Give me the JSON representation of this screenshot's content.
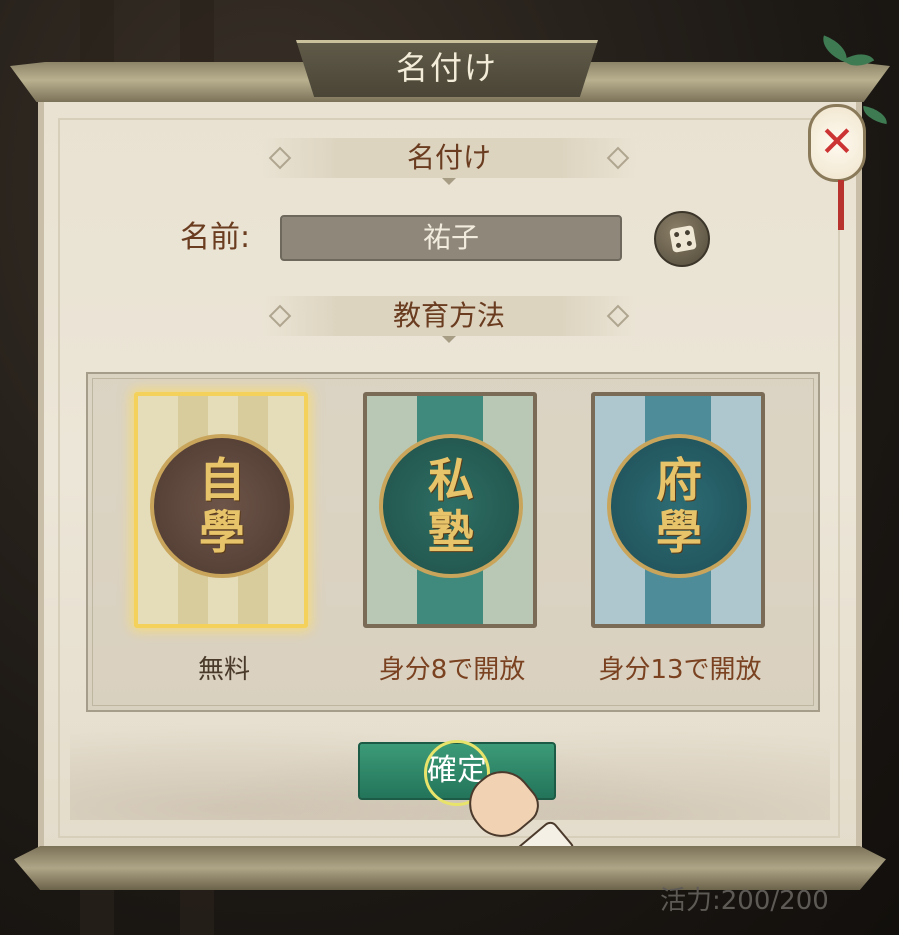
{
  "dialog": {
    "title": "名付け",
    "close_glyph": "✕"
  },
  "naming": {
    "section_title": "名付け",
    "name_label": "名前:",
    "name_value": "祐子",
    "dice_icon": "dice-icon"
  },
  "education": {
    "section_title": "教育方法",
    "options": [
      {
        "glyphs": [
          "自",
          "學"
        ],
        "caption": "無料",
        "selected": true,
        "caption_color": "#4a3a2a"
      },
      {
        "glyphs": [
          "私",
          "塾"
        ],
        "caption": "身分8で開放",
        "selected": false,
        "caption_color": "#7a4220"
      },
      {
        "glyphs": [
          "府",
          "學"
        ],
        "caption": "身分13で開放",
        "selected": false,
        "caption_color": "#7a4220"
      }
    ]
  },
  "confirm": {
    "label": "確定"
  },
  "status": {
    "stamina": "活力:200/200"
  },
  "colors": {
    "accent_green": "#2e8a68",
    "text_brown": "#6a3c20",
    "selected_glow": "#f3d15a"
  }
}
